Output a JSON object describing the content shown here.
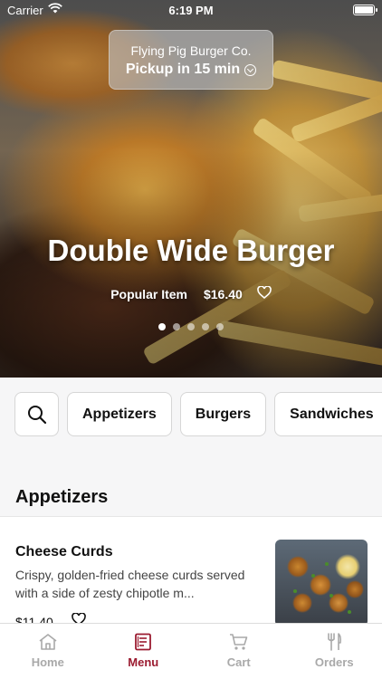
{
  "status_bar": {
    "carrier": "Carrier",
    "time": "6:19 PM"
  },
  "pickup": {
    "restaurant": "Flying Pig Burger Co.",
    "status": "Pickup in 15 min"
  },
  "hero": {
    "title": "Double Wide Burger",
    "tag": "Popular Item",
    "price": "$16.40",
    "carousel": {
      "count": 5,
      "active_index": 0
    }
  },
  "categories": [
    "Appetizers",
    "Burgers",
    "Sandwiches"
  ],
  "section": {
    "title": "Appetizers"
  },
  "items": [
    {
      "name": "Cheese Curds",
      "description": "Crispy, golden-fried cheese curds served with a side of zesty chipotle m...",
      "price": "$11.40"
    }
  ],
  "tabs": [
    {
      "label": "Home",
      "icon": "home-icon",
      "active": false
    },
    {
      "label": "Menu",
      "icon": "menu-icon",
      "active": true
    },
    {
      "label": "Cart",
      "icon": "cart-icon",
      "active": false
    },
    {
      "label": "Orders",
      "icon": "fork-knife-icon",
      "active": false
    }
  ],
  "colors": {
    "accent": "#9b1b30",
    "tab_inactive": "#a9a9a9",
    "background": "#f6f6f7"
  }
}
